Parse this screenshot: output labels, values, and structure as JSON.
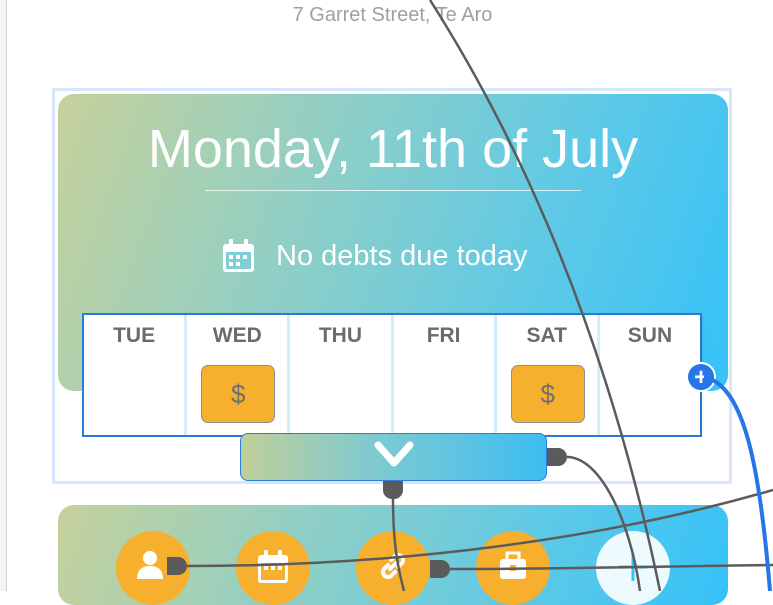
{
  "header": {
    "address": "7 Garret Street, Te Aro"
  },
  "date_card": {
    "title": "Monday, 11th of July",
    "status_text": "No debts due today"
  },
  "week": {
    "days": [
      {
        "label": "TUE",
        "has_debt": false
      },
      {
        "label": "WED",
        "has_debt": true
      },
      {
        "label": "THU",
        "has_debt": false
      },
      {
        "label": "FRI",
        "has_debt": false
      },
      {
        "label": "SAT",
        "has_debt": true
      },
      {
        "label": "SUN",
        "has_debt": false
      }
    ],
    "debt_symbol": "$"
  },
  "add_connector_symbol": "+",
  "nav": {
    "items": [
      {
        "icon": "user-icon"
      },
      {
        "icon": "calendar-icon"
      },
      {
        "icon": "link-icon"
      },
      {
        "icon": "briefcase-icon"
      },
      {
        "icon": "plus-icon"
      }
    ]
  },
  "colors": {
    "accent_blue": "#2776e8",
    "badge_orange": "#f6b02e",
    "wire_gray": "#5b5b5b",
    "gradient_start": "#c6d19a",
    "gradient_end": "#35c2f8"
  }
}
